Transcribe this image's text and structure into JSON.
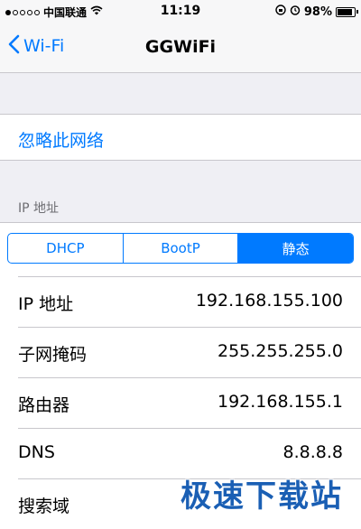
{
  "status_bar": {
    "carrier": "中国联通",
    "time": "11:19",
    "battery_percent": "98%",
    "battery_level": 0.98,
    "icons": [
      "signal-dots-icon",
      "wifi-icon",
      "rotation-lock-icon",
      "alarm-icon",
      "battery-icon"
    ]
  },
  "nav": {
    "back_label": "Wi-Fi",
    "title": "GGWiFi"
  },
  "forget_network": "忽略此网络",
  "section_header": "IP 地址",
  "segments": {
    "items": [
      "DHCP",
      "BootP",
      "静态"
    ],
    "selected": "静态"
  },
  "rows": [
    {
      "label": "IP 地址",
      "value": "192.168.155.100"
    },
    {
      "label": "子网掩码",
      "value": "255.255.255.0"
    },
    {
      "label": "路由器",
      "value": "192.168.155.1"
    },
    {
      "label": "DNS",
      "value": "8.8.8.8"
    },
    {
      "label": "搜索域",
      "value": ""
    }
  ],
  "watermark": "极速下载站",
  "colors": {
    "accent": "#007aff",
    "background": "#efeff4",
    "separator": "#c8c7cc"
  }
}
